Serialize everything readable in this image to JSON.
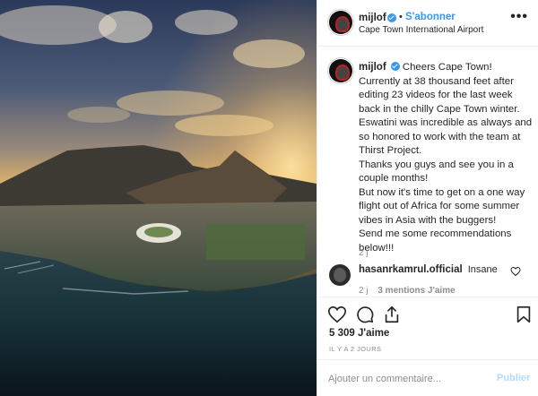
{
  "post": {
    "username": "mijlof",
    "follow_label": "S'abonner",
    "separator": "•",
    "location": "Cape Town International Airport",
    "more_label": "•••"
  },
  "caption": {
    "username": "mijlof",
    "text": "Cheers Cape Town! Currently at 38 thousand feet after editing 23 videos for the last week back in the chilly Cape Town winter. Eswatini was incredible as always and so honored to work with the team at Thirst Project.\nThanks you guys and see you in a couple months!\nBut now it's time to get on a one way flight out of Africa for some summer vibes in Asia with the buggers!\nSend me some recommendations below!!!",
    "time": "2 j"
  },
  "comments": [
    {
      "username": "hasanrkamrul.official",
      "text": "Insane",
      "time": "2 j",
      "mentions": "3 mentions J'aime"
    }
  ],
  "actions": {
    "likes": "5 309 J'aime",
    "posted_ago": "IL Y A 2 JOURS"
  },
  "add_comment": {
    "placeholder": "Ajouter un commentaire...",
    "publish_label": "Publier"
  },
  "icons": [
    "verified-icon",
    "more-options-icon",
    "heart-icon",
    "comment-icon",
    "share-icon",
    "bookmark-icon"
  ],
  "colors": {
    "link_blue": "#3897f0",
    "publish_disabled": "#b3dbff",
    "muted": "#8e8e8e",
    "text": "#262626"
  }
}
